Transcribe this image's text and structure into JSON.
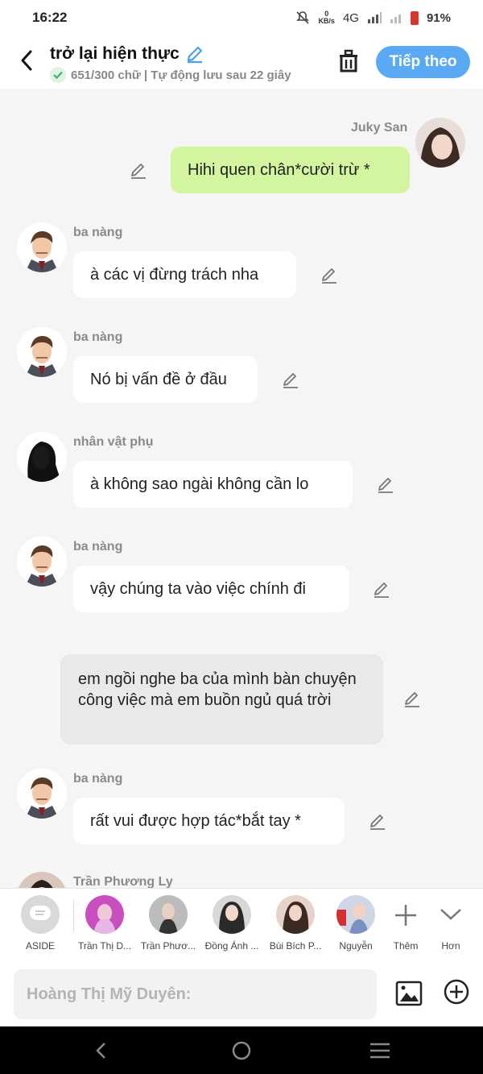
{
  "status": {
    "time": "16:22",
    "netspeed_value": "0",
    "netspeed_unit": "KB/s",
    "network": "4G",
    "battery": "91%"
  },
  "header": {
    "title": "trở lại hiện thực",
    "subtitle": "651/300 chữ | Tự động lưu sau 22 giây",
    "next_button": "Tiếp theo"
  },
  "messages": [
    {
      "sender": "Juky San",
      "text": "Hihi quen chân*cười trừ *",
      "side": "right"
    },
    {
      "sender": "ba nàng",
      "text": "à các vị đừng trách nha",
      "side": "left"
    },
    {
      "sender": "ba nàng",
      "text": "Nó bị vấn đề ở đầu",
      "side": "left"
    },
    {
      "sender": "nhân vật phụ",
      "text": "à không sao ngài không cần lo",
      "side": "left"
    },
    {
      "sender": "ba nàng",
      "text": "vậy chúng ta vào việc chính đi",
      "side": "left"
    },
    {
      "sender": "",
      "text": "em ngồi nghe ba của mình bàn chuyện công việc mà em buồn ngủ quá trời",
      "side": "narration"
    },
    {
      "sender": "ba nàng",
      "text": "rất vui được hợp tác*bắt tay *",
      "side": "left"
    },
    {
      "sender": "Trần Phương Ly",
      "text": "",
      "side": "left"
    }
  ],
  "characters": [
    {
      "name": "ASIDE"
    },
    {
      "name": "Trần Thị D..."
    },
    {
      "name": "Trần Phươ..."
    },
    {
      "name": "Đồng Ánh ..."
    },
    {
      "name": "Bùi Bích P..."
    },
    {
      "name": "Nguyễn"
    }
  ],
  "char_actions": {
    "more": "Thêm",
    "expand": "Hơn"
  },
  "input": {
    "placeholder": "Hoàng Thị Mỹ Duyên:"
  },
  "colors": {
    "accent": "#5aa9f5",
    "my_bubble": "#d4f5a0",
    "narration_bubble": "#e9e9e9"
  },
  "icons": [
    "back-arrow-icon",
    "pencil-icon",
    "check-icon",
    "trash-icon",
    "edit-icon",
    "image-icon",
    "add-circle-icon",
    "plus-icon",
    "chevron-down-icon",
    "nav-back-icon",
    "nav-home-icon",
    "nav-menu-icon"
  ]
}
